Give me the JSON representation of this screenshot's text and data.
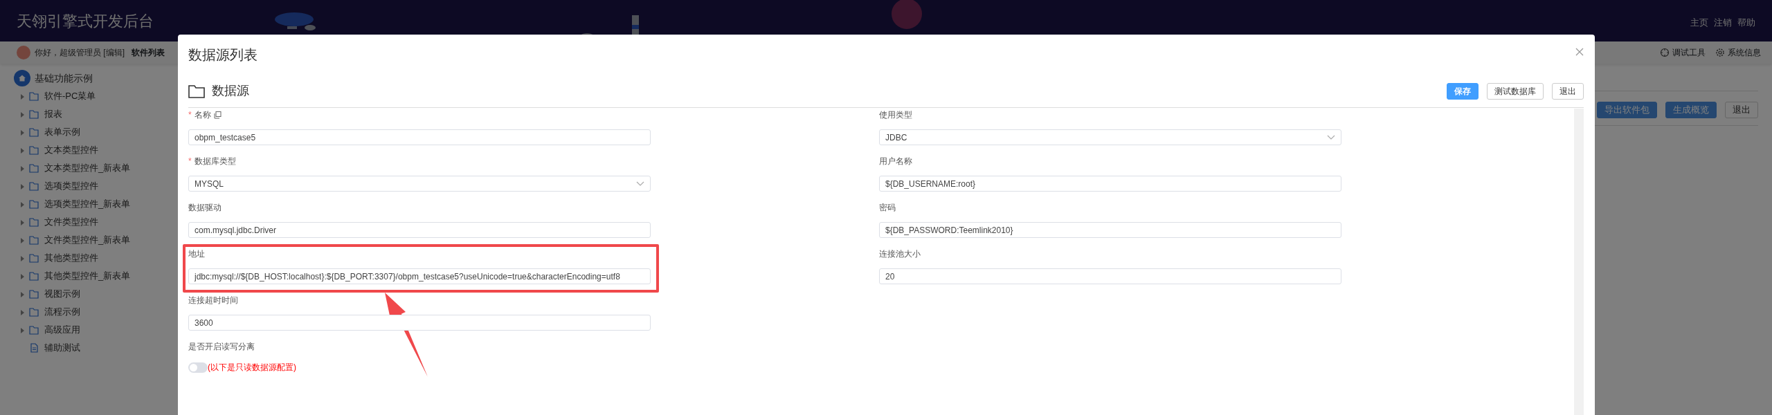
{
  "header": {
    "title": "天翎引擎式开发后台",
    "links": [
      "主页",
      "注销",
      "帮助"
    ]
  },
  "subbar": {
    "greeting": "你好，超级管理员 [编辑]",
    "tab": "软件列表",
    "tools": [
      {
        "label": "调试工具",
        "kind": "debug"
      },
      {
        "label": "系统信息",
        "kind": "settings"
      }
    ]
  },
  "sidebar": {
    "root": "基础功能示例",
    "children": [
      {
        "label": "软件-PC菜单",
        "kind": "folder",
        "expanded": false
      },
      {
        "label": "报表",
        "kind": "folder",
        "expanded": false
      },
      {
        "label": "表单示例",
        "kind": "folder",
        "expanded": false
      },
      {
        "label": "文本类型控件",
        "kind": "folder",
        "expanded": false
      },
      {
        "label": "文本类型控件_新表单",
        "kind": "folder",
        "expanded": false
      },
      {
        "label": "选项类型控件",
        "kind": "folder",
        "expanded": false
      },
      {
        "label": "选项类型控件_新表单",
        "kind": "folder",
        "expanded": false
      },
      {
        "label": "文件类型控件",
        "kind": "folder",
        "expanded": false
      },
      {
        "label": "文件类型控件_新表单",
        "kind": "folder",
        "expanded": false
      },
      {
        "label": "其他类型控件",
        "kind": "folder",
        "expanded": false
      },
      {
        "label": "其他类型控件_新表单",
        "kind": "folder",
        "expanded": false
      },
      {
        "label": "视图示例",
        "kind": "folder",
        "expanded": false
      },
      {
        "label": "流程示例",
        "kind": "folder",
        "expanded": false
      },
      {
        "label": "高级应用",
        "kind": "folder",
        "expanded": false
      },
      {
        "label": "辅助测试",
        "kind": "file"
      }
    ]
  },
  "background_actions": [
    {
      "label": "导出软件包",
      "kind": "primary"
    },
    {
      "label": "生成概览",
      "kind": "primary"
    },
    {
      "label": "退出",
      "kind": "default"
    }
  ],
  "modal": {
    "title": "数据源列表",
    "section": "数据源",
    "buttons": [
      {
        "label": "保存",
        "kind": "primary"
      },
      {
        "label": "测试数据库",
        "kind": "default"
      },
      {
        "label": "退出",
        "kind": "default"
      }
    ],
    "left_fields": [
      {
        "required_mark": "*",
        "label": "名称",
        "copy_icon": true,
        "kind": "text",
        "value": "obpm_testcase5"
      },
      {
        "required_mark": "*",
        "label": "数据库类型",
        "kind": "select",
        "value": "MYSQL"
      },
      {
        "label": "数据驱动",
        "kind": "text",
        "value": "com.mysql.jdbc.Driver"
      },
      {
        "label": "地址",
        "kind": "text",
        "value": "jdbc:mysql://${DB_HOST:localhost}:${DB_PORT:3307}/obpm_testcase5?useUnicode=true&characterEncoding=utf8",
        "highlighted": true
      },
      {
        "label": "连接超时时间",
        "kind": "text",
        "value": "3600"
      },
      {
        "label": "是否开启读写分离",
        "kind": "switch",
        "on": false,
        "note": "(以下是只读数据源配置)"
      }
    ],
    "right_fields": [
      {
        "label": "使用类型",
        "kind": "select",
        "value": "JDBC"
      },
      {
        "label": "用户名称",
        "kind": "text",
        "value": "${DB_USERNAME:root}"
      },
      {
        "label": "密码",
        "kind": "text",
        "value": "${DB_PASSWORD:Teemlink2010}"
      },
      {
        "label": "连接池大小",
        "kind": "text",
        "value": "20"
      }
    ]
  }
}
